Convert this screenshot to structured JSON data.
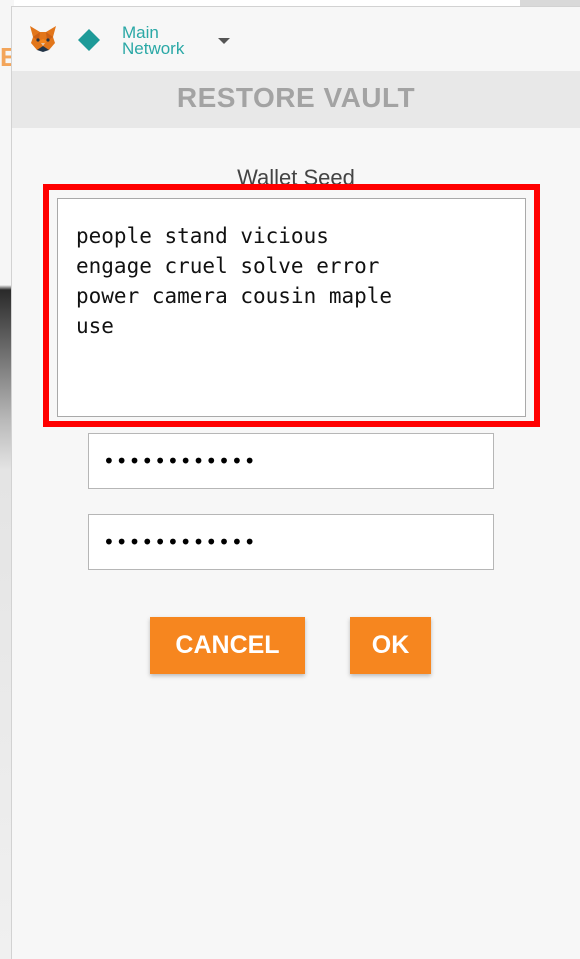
{
  "background": {
    "peek_text": "E"
  },
  "header": {
    "logo_icon": "fox-icon",
    "network_icon": "diamond-icon",
    "network_line1": "Main",
    "network_line2": "Network",
    "dropdown_icon": "caret-down-icon"
  },
  "title": "RESTORE VAULT",
  "form": {
    "seed_label": "Wallet Seed",
    "seed_value": "people stand vicious\nengage cruel solve error\npower camera cousin maple\nuse",
    "password_value": "••••••••••••",
    "confirm_password_value": "••••••••••••",
    "cancel_label": "CANCEL",
    "ok_label": "OK"
  },
  "colors": {
    "accent": "#f6861f",
    "network_teal": "#2aa8a6",
    "highlight_border": "#ff0000",
    "title_text": "#a3a3a3"
  }
}
